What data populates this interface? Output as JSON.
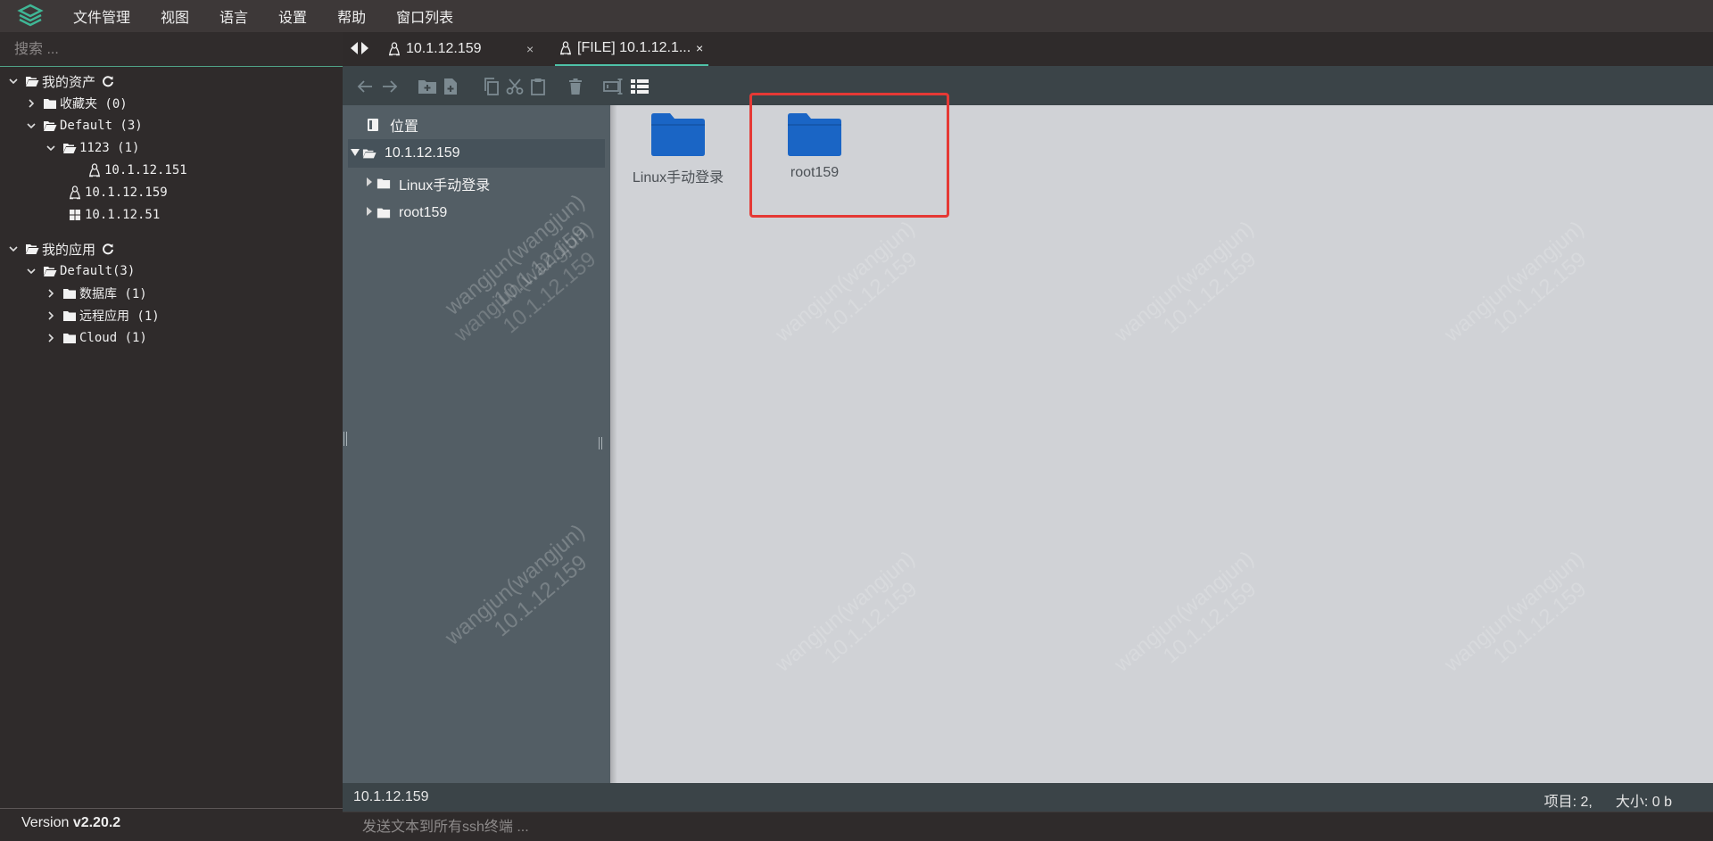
{
  "menu": [
    "文件管理",
    "视图",
    "语言",
    "设置",
    "帮助",
    "窗口列表"
  ],
  "colors": {
    "accent": "#4ec2a7",
    "folder": "#1a65c5",
    "highlight": "#e53935"
  },
  "sidebar": {
    "search_placeholder": "搜索 ...",
    "assets": {
      "label": "我的资产",
      "favorites": "收藏夹 (0)",
      "default": "Default (3)",
      "group_1123": "1123 (1)",
      "host_151": "10.1.12.151",
      "host_159": "10.1.12.159",
      "host_51": "10.1.12.51"
    },
    "apps": {
      "label": "我的应用",
      "default": "Default(3)",
      "database": "数据库 (1)",
      "remote_app": "远程应用 (1)",
      "cloud": "Cloud (1)"
    },
    "version_prefix": "Version ",
    "version_number": "v2.20.2"
  },
  "tabs": [
    {
      "label": "10.1.12.159",
      "close": "×"
    },
    {
      "label": "[FILE] 10.1.12.1...",
      "close": "×"
    }
  ],
  "folder_tree": {
    "location": "位置",
    "root": "10.1.12.159",
    "children": [
      "Linux手动登录",
      "root159"
    ]
  },
  "files": [
    {
      "name": "Linux手动登录"
    },
    {
      "name": "root159"
    }
  ],
  "watermark": {
    "line1": "wangjun(wangjun)",
    "line2": "10.1.12.159"
  },
  "status": {
    "path": "10.1.12.159",
    "items": "项目: 2,",
    "size": "大小: 0 b"
  },
  "send_placeholder": "发送文本到所有ssh终端 ..."
}
